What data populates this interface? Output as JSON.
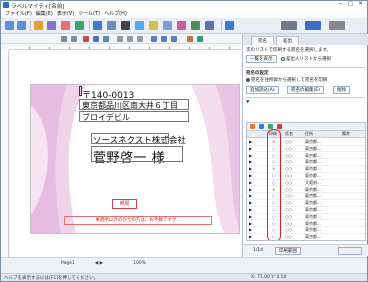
{
  "window": {
    "title": "ラベルマイティ[名前]",
    "controls": [
      "─",
      "□",
      "✕"
    ]
  },
  "menu": [
    "ファイル(F)",
    "編集(E)",
    "表示(V)",
    "ツール(T)",
    "ヘルプ(H)"
  ],
  "toolbar": {
    "items": [
      {
        "label": "",
        "icon": "back-icon"
      },
      {
        "label": "",
        "icon": "forward-icon"
      },
      {
        "label": "",
        "icon": "pen-icon"
      },
      {
        "label": "",
        "icon": "image-icon"
      },
      {
        "label": "",
        "icon": "text-icon"
      },
      {
        "label": "",
        "icon": "shape-icon"
      },
      {
        "label": "",
        "icon": "table-icon"
      },
      {
        "label": "",
        "icon": "print-icon"
      },
      {
        "label": "",
        "icon": "save-icon"
      }
    ]
  },
  "card": {
    "postal": "〒140-0013",
    "address1": "東京都品川区南大井６丁目",
    "address2": "ブロイデビル",
    "company": "ソースネクスト株式会社",
    "recipient": "菅野啓一 様",
    "stamp": "親展",
    "notice": "事務所以外のかたの方は、お手数ですが..."
  },
  "panel": {
    "tabs": [
      "宛名",
      "差出"
    ],
    "intro": "次のリストで印刷する宛名を選択します。",
    "button1": "一覧を表示",
    "option1": "差出人リストから選択",
    "section": "宛名の設定",
    "option2": "宛名を住所録から選択して宛名を印刷",
    "btn_a": "追加読込(A)",
    "btn_b": "宛名の編集(E)",
    "btn_c": "削除",
    "grid_headers": [
      "印刷",
      "氏名",
      "住所",
      "備考"
    ],
    "grid_rows": [
      {
        "print": "×",
        "name": "○○",
        "addr": "東京都..."
      },
      {
        "print": "○",
        "name": "○○",
        "addr": "東京都..."
      },
      {
        "print": "○",
        "name": "○○",
        "addr": "東京都..."
      },
      {
        "print": "○",
        "name": "○○",
        "addr": "東京都..."
      },
      {
        "print": "×",
        "name": "○○",
        "addr": "東京都..."
      },
      {
        "print": "○",
        "name": "○○",
        "addr": "東京都..."
      },
      {
        "print": "○",
        "name": "○○",
        "addr": "大阪府..."
      },
      {
        "print": "×",
        "name": "○○",
        "addr": "東京都..."
      },
      {
        "print": "○",
        "name": "○○",
        "addr": "東京都..."
      },
      {
        "print": "○",
        "name": "○○",
        "addr": "東京都..."
      },
      {
        "print": "○",
        "name": "○○",
        "addr": "東京都..."
      },
      {
        "print": "○",
        "name": "○○",
        "addr": "東京都..."
      },
      {
        "print": "○",
        "name": "○○",
        "addr": "東京都..."
      },
      {
        "print": "○",
        "name": "○○",
        "addr": "東京都..."
      },
      {
        "print": "○",
        "name": "○○",
        "addr": "東京都..."
      }
    ],
    "foot_count": "1/14",
    "foot_btn": "印刷範囲"
  },
  "status": {
    "page": "Page1",
    "zoom": "100%",
    "hint": "ヘルプを表示するには[F1]を押してください。",
    "coords": "X: 71.00 Y: 0.50"
  }
}
